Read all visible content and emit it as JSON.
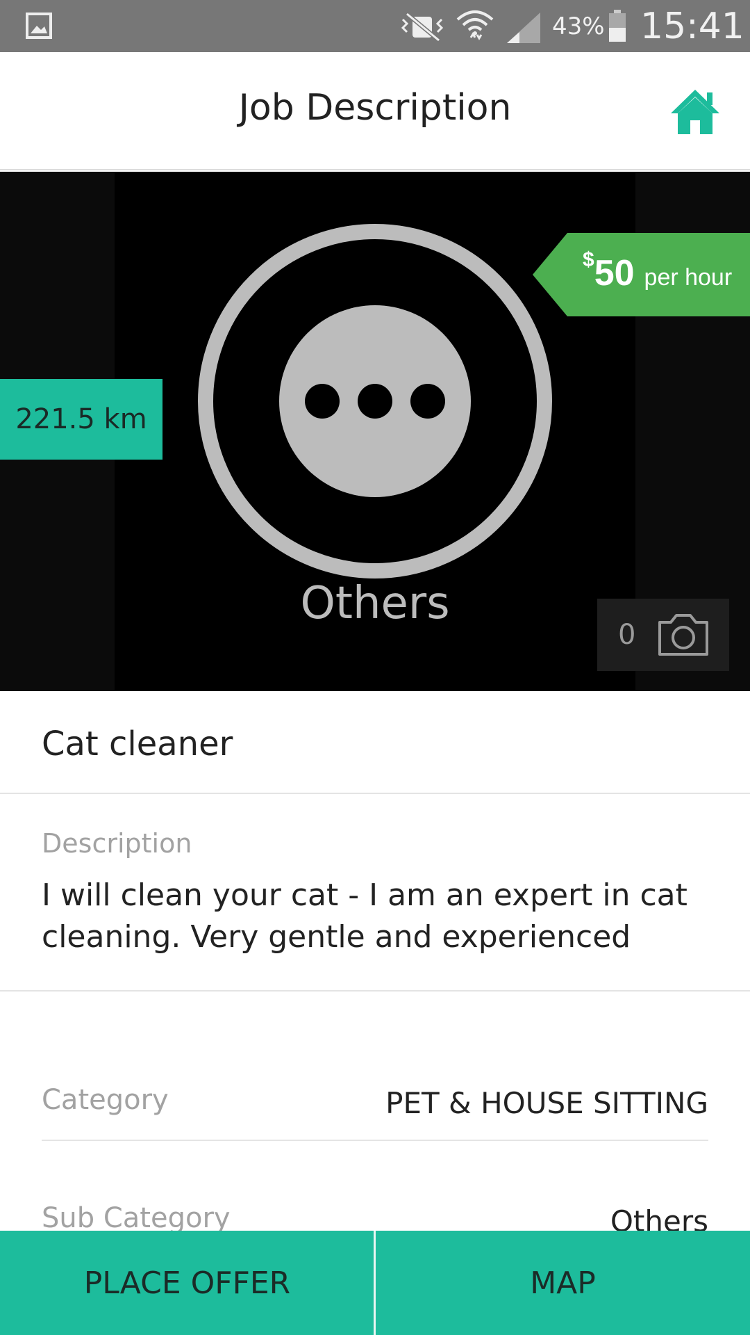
{
  "status_bar": {
    "battery_percent": "43%",
    "time": "15:41",
    "icons": [
      "gallery-icon",
      "mute-icon",
      "wifi-icon",
      "signal-icon",
      "battery-icon"
    ]
  },
  "header": {
    "title": "Job Description",
    "home_icon": "home-icon"
  },
  "hero": {
    "category": "Others",
    "distance": "221.5 km",
    "price": {
      "currency": "$",
      "amount": "50",
      "unit": "per hour"
    },
    "photo_count": "0"
  },
  "job": {
    "title": "Cat cleaner",
    "description_label": "Description",
    "description": "I will clean your cat - I am an expert in cat cleaning. Very gentle and experienced"
  },
  "details": [
    {
      "label": "Category",
      "value": "PET & HOUSE SITTING"
    },
    {
      "label": "Sub Category",
      "value": "Others"
    }
  ],
  "actions": {
    "place_offer": "PLACE OFFER",
    "map": "MAP"
  },
  "colors": {
    "accent": "#1dbc9c",
    "price_tag": "#4caf50",
    "status_bar": "#777777"
  }
}
